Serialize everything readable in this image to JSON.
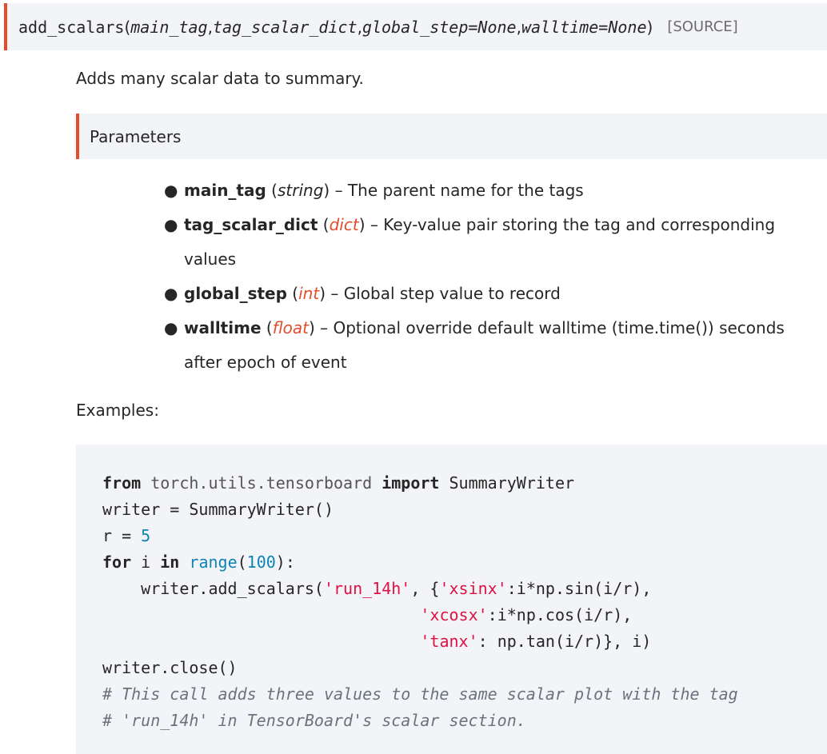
{
  "signature": {
    "name": "add_scalars",
    "open_paren": "(",
    "params": [
      "main_tag",
      "tag_scalar_dict",
      "global_step=None",
      "walltime=None"
    ],
    "separator": ", ",
    "close_paren": ")",
    "source_label": "[SOURCE]"
  },
  "summary": "Adds many scalar data to summary.",
  "parameters_title": "Parameters",
  "parameters": [
    {
      "name": "main_tag",
      "type": "string",
      "type_linked": false,
      "desc": " – The parent name for the tags"
    },
    {
      "name": "tag_scalar_dict",
      "type": "dict",
      "type_linked": true,
      "desc": " – Key-value pair storing the tag and corresponding values"
    },
    {
      "name": "global_step",
      "type": "int",
      "type_linked": true,
      "desc": " – Global step value to record"
    },
    {
      "name": "walltime",
      "type": "float",
      "type_linked": true,
      "desc": " – Optional override default walltime (time.time()) seconds after epoch of event"
    }
  ],
  "examples_label": "Examples:",
  "code": {
    "line1": {
      "kw_from": "from",
      "module": "torch.utils.tensorboard",
      "kw_import": "import",
      "name": "SummaryWriter"
    },
    "line2": {
      "text": "writer = SummaryWriter()"
    },
    "line3": {
      "text": "r = ",
      "num": "5"
    },
    "line4": {
      "kw_for": "for",
      "var": "i",
      "kw_in": "in",
      "builtin": "range",
      "open": "(",
      "num": "100",
      "close": "):"
    },
    "line5": {
      "prefix": "    writer.add_scalars(",
      "str1": "'run_14h'",
      "mid": ", {",
      "str2": "'xsinx'",
      "rest": ":i*np.sin(i/r),"
    },
    "line6": {
      "indent": "                                 ",
      "str": "'xcosx'",
      "rest": ":i*np.cos(i/r),"
    },
    "line7": {
      "indent": "                                 ",
      "str": "'tanx'",
      "rest": ": np.tan(i/r)}, i)"
    },
    "line8": {
      "text": "writer.close()"
    },
    "line9": {
      "comment": "# This call adds three values to the same scalar plot with the tag"
    },
    "line10": {
      "comment": "# 'run_14h' in TensorBoard's scalar section."
    }
  },
  "colors": {
    "accent": "#e44c2c",
    "panel_bg": "#f3f4f7",
    "string": "#dd1144",
    "number": "#0e84b5",
    "comment": "#6a737d"
  }
}
